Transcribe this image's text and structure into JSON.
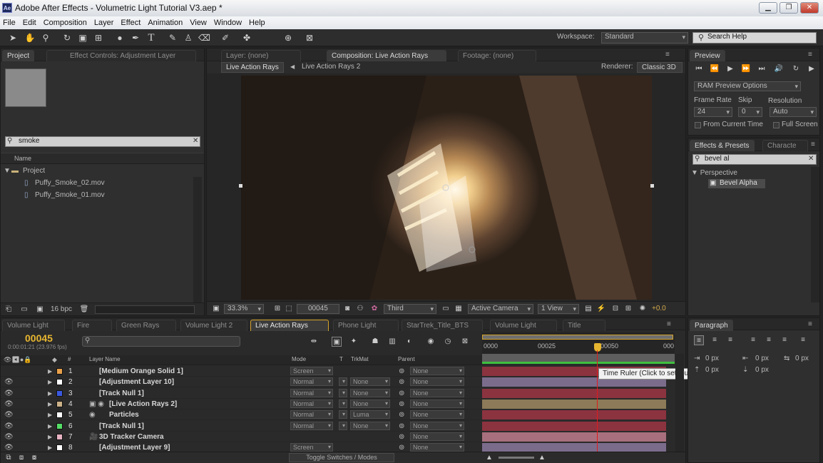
{
  "window": {
    "app_badge": "Ae",
    "title": "Adobe After Effects - Volumetric Light Tutorial V3.aep *"
  },
  "menu": [
    "File",
    "Edit",
    "Composition",
    "Layer",
    "Effect",
    "Animation",
    "View",
    "Window",
    "Help"
  ],
  "toolbar": {
    "workspace_label": "Workspace:",
    "workspace_value": "Standard",
    "search_help": "Search Help"
  },
  "project": {
    "tab_project": "Project",
    "tab_effect_controls": "Effect Controls: Adjustment Layer",
    "search_value": "smoke",
    "col_name": "Name",
    "folder": "Project",
    "items": [
      "Puffy_Smoke_02.mov",
      "Puffy_Smoke_01.mov"
    ],
    "bpc": "16 bpc"
  },
  "comp": {
    "tab_layer": "Layer: (none)",
    "tab_comp": "Composition: Live Action Rays",
    "tab_footage": "Footage: (none)",
    "breadcrumb": [
      "Live Action Rays",
      "Live Action Rays 2"
    ],
    "renderer_label": "Renderer:",
    "renderer_value": "Classic 3D",
    "zoom": "33.3%",
    "frame": "00045",
    "resolution": "Third",
    "camera": "Active Camera",
    "views": "1 View",
    "exposure": "+0.0"
  },
  "preview": {
    "tab": "Preview",
    "ram_options": "RAM Preview Options",
    "frame_rate_label": "Frame Rate",
    "skip_label": "Skip",
    "resolution_label": "Resolution",
    "frame_rate": "24",
    "skip": "0",
    "resolution": "Auto",
    "from_current": "From Current Time",
    "full_screen": "Full Screen"
  },
  "effects": {
    "tab": "Effects & Presets",
    "tab2": "Characte",
    "search_value": "bevel al",
    "category": "Perspective",
    "item": "Bevel Alpha"
  },
  "paragraph": {
    "tab": "Paragraph",
    "values": [
      "0 px",
      "0 px",
      "0 px",
      "0 px",
      "0 px"
    ]
  },
  "timeline": {
    "tabs": [
      "Volume Light",
      "Fire",
      "Green Rays",
      "Volume Light 2",
      "Live Action Rays",
      "Phone Light",
      "StarTrek_Title_BTS",
      "Volume Light",
      "Title"
    ],
    "active_tab": 4,
    "timecode": "00045",
    "timecode_sub": "0:00:01:21 (23.976 fps)",
    "headers": {
      "num": "#",
      "name": "Layer Name",
      "mode": "Mode",
      "t": "T",
      "trkmat": "TrkMat",
      "parent": "Parent"
    },
    "ruler": [
      "0000",
      "00025",
      "00050",
      "000"
    ],
    "tooltip": "Time Ruler (Click to set thumb)",
    "toggle": "Toggle Switches / Modes",
    "layers": [
      {
        "num": "1",
        "name": "[Medium Orange Solid 1]",
        "color": "#e8a04a",
        "mode": "Screen",
        "trkmat": "",
        "parent": "None",
        "bar": "#8c3340"
      },
      {
        "num": "2",
        "name": "[Adjustment Layer 10]",
        "color": "#ffffff",
        "mode": "Normal",
        "trkmat": "None",
        "parent": "None",
        "bar": "#7c6c8c"
      },
      {
        "num": "3",
        "name": "[Track Null 1]",
        "color": "#3a58e0",
        "mode": "Normal",
        "trkmat": "None",
        "parent": "None",
        "bar": "#8c3340"
      },
      {
        "num": "4",
        "name": "[Live Action Rays 2]",
        "color": "#cdb28a",
        "mode": "Normal",
        "trkmat": "None",
        "parent": "None",
        "bar": "#8c7a58"
      },
      {
        "num": "5",
        "name": "Particles",
        "color": "#ffffff",
        "mode": "Normal",
        "trkmat": "Luma",
        "parent": "None",
        "bar": "#8c3340"
      },
      {
        "num": "6",
        "name": "[Track Null 1]",
        "color": "#55dd66",
        "mode": "Normal",
        "trkmat": "None",
        "parent": "None",
        "bar": "#8c3340"
      },
      {
        "num": "7",
        "name": "3D Tracker Camera",
        "color": "#e7b3c3",
        "mode": "",
        "trkmat": "",
        "parent": "None",
        "bar": "#a8707e"
      },
      {
        "num": "8",
        "name": "[Adjustment Layer 9]",
        "color": "#ffffff",
        "mode": "Screen",
        "trkmat": "",
        "parent": "None",
        "bar": "#7c6c8c"
      }
    ]
  }
}
